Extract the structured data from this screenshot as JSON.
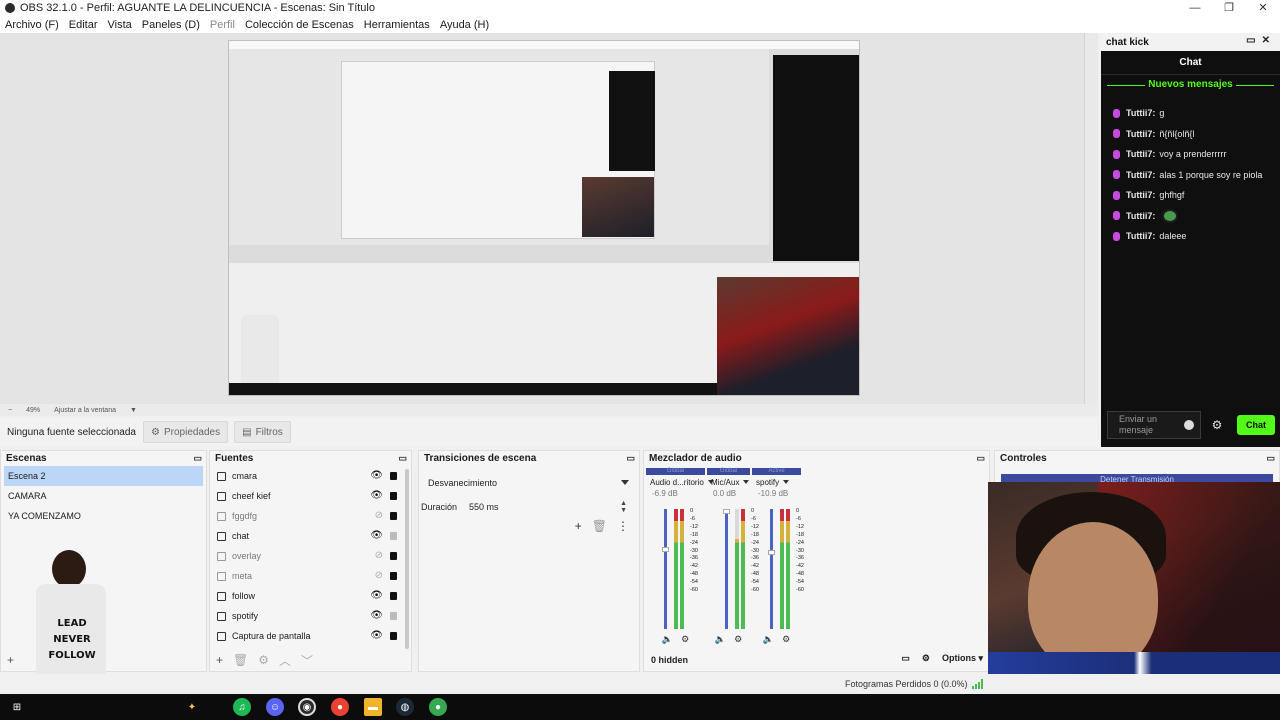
{
  "window": {
    "title": "OBS 32.1.0 - Perfil: AGUANTE LA DELINCUENCIA - Escenas: Sin Título",
    "controls": [
      "—",
      "❐",
      "✕"
    ]
  },
  "menu": [
    "Archivo (F)",
    "Editar",
    "Vista",
    "Paneles (D)",
    "Perfil",
    "Colección de Escenas",
    "Herramientas",
    "Ayuda (H)"
  ],
  "zoom": {
    "level": "49%",
    "mode": "Ajustar a la ventana"
  },
  "source_toolbar": {
    "no_source": "Ninguna fuente seleccionada",
    "properties": "Propiedades",
    "filters": "Filtros"
  },
  "chat_dock": {
    "dock_title": "chat kick",
    "header": "Chat",
    "new_messages": "Nuevos mensajes",
    "messages": [
      {
        "user": "Tuttii7:",
        "text": "g",
        "emote": false
      },
      {
        "user": "Tuttii7:",
        "text": "ñ{ñl{olñ{l",
        "emote": false
      },
      {
        "user": "Tuttii7:",
        "text": "voy a prenderrrrr",
        "emote": false
      },
      {
        "user": "Tuttii7:",
        "text": "alas 1 porque soy re piola",
        "emote": false
      },
      {
        "user": "Tuttii7:",
        "text": "ghfhgf",
        "emote": false
      },
      {
        "user": "Tuttii7:",
        "text": "",
        "emote": true
      },
      {
        "user": "Tuttii7:",
        "text": "daleee",
        "emote": false
      }
    ],
    "input_placeholder": "Enviar un mensaje",
    "send_label": "Chat",
    "accent": "#53fc18"
  },
  "scenes": {
    "title": "Escenas",
    "items": [
      "Escena 2",
      "CAMARA",
      "YA COMENZAMO"
    ],
    "active_index": 0
  },
  "sources": {
    "title": "Fuentes",
    "items": [
      {
        "name": "cmara",
        "visible": true,
        "locked": true
      },
      {
        "name": "cheef kief",
        "visible": true,
        "locked": true
      },
      {
        "name": "fggdfg",
        "visible": false,
        "locked": true
      },
      {
        "name": "chat",
        "visible": true,
        "locked": false
      },
      {
        "name": "overlay",
        "visible": false,
        "locked": true
      },
      {
        "name": "meta",
        "visible": false,
        "locked": true
      },
      {
        "name": "follow",
        "visible": true,
        "locked": true
      },
      {
        "name": "spotify",
        "visible": true,
        "locked": false
      },
      {
        "name": "Captura de pantalla",
        "visible": true,
        "locked": true
      }
    ]
  },
  "transitions": {
    "title": "Transiciones de escena",
    "selected": "Desvanecimiento",
    "duration_label": "Duración",
    "duration_value": "550 ms"
  },
  "mixer": {
    "title": "Mezclador de audio",
    "channels": [
      {
        "status": "Global",
        "name": "Audio d...ritorio",
        "db": "-6.9 dB",
        "level": 0.33
      },
      {
        "status": "Global",
        "name": "Mic/Aux",
        "db": "0.0 dB",
        "level": 0.0
      },
      {
        "status": "Active",
        "name": "spotify",
        "db": "-10.9 dB",
        "level": 0.36
      }
    ],
    "scale": [
      "0",
      "-6",
      "-12",
      "-18",
      "-24",
      "-30",
      "-36",
      "-42",
      "-48",
      "-54",
      "-60"
    ],
    "hidden": "0 hidden",
    "options": "Options"
  },
  "controls": {
    "title": "Controles",
    "stop_stream": "Detener Transmisión"
  },
  "status": {
    "frames_dropped": "Fotogramas Perdidos 0 (0.0%)"
  },
  "overlay_text": {
    "shirt": [
      "LEAD",
      "NEVER",
      "FOLLOW"
    ]
  },
  "taskbar_apps": [
    "windows-start",
    "spotify",
    "discord",
    "obs",
    "chrome",
    "explorer",
    "steam",
    "chrome-alt"
  ]
}
